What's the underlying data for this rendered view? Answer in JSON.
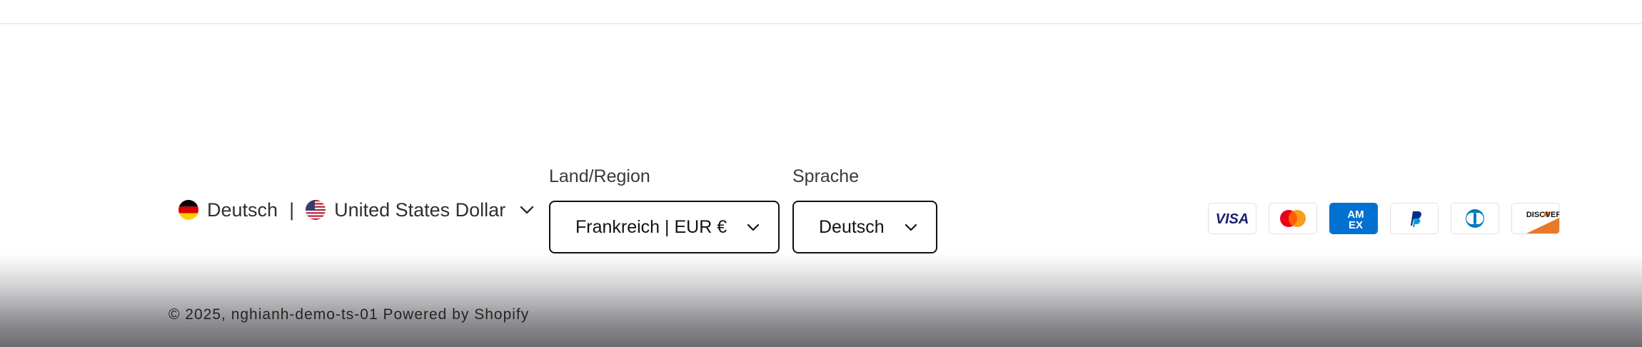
{
  "localization": {
    "language": "Deutsch",
    "separator": "|",
    "currency": "United States Dollar"
  },
  "country_selector": {
    "label": "Land/Region",
    "value": "Frankreich | EUR €"
  },
  "language_selector": {
    "label": "Sprache",
    "value": "Deutsch"
  },
  "payment_icons": [
    "visa-icon",
    "mastercard-icon",
    "american-express-icon",
    "paypal-icon",
    "diners-club-icon",
    "discover-icon"
  ],
  "footer": {
    "copyright": "© 2025, nghianh-demo-ts-01 Powered by Shopify"
  },
  "colors": {
    "text": "#121212",
    "border": "#121212",
    "amex": "#0070d1",
    "visa": "#1a1f71",
    "discover": "#e8792b"
  }
}
